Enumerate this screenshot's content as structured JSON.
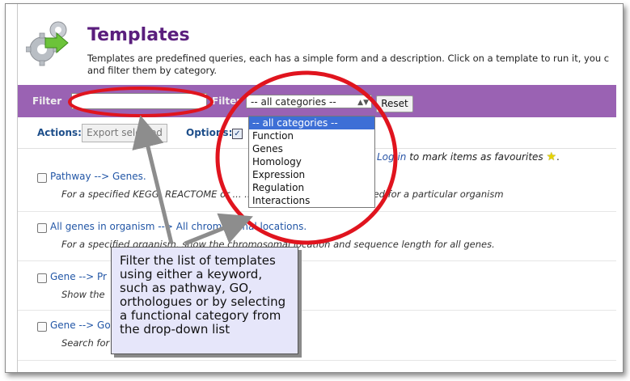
{
  "header": {
    "title": "Templates",
    "description_line1": "Templates are predefined queries, each has a simple form and a description. Click on a template to run it, you c",
    "description_line2": "and filter them by category."
  },
  "filterbar": {
    "filter_label1": "Filter",
    "filter_label2": "Filter",
    "text_value": "",
    "category_selected": "-- all categories --",
    "reset_label": "Reset"
  },
  "actions": {
    "label": "Actions:",
    "export_label": "Export selected",
    "options_label": "Options:"
  },
  "favourites": {
    "login_link": "Log in",
    "text": " to mark items as favourites",
    "period": "."
  },
  "templates": [
    {
      "name": "Pathway --> Genes.",
      "desc": "For a specified KEGG, REACTOME or ...     ... the genes that are involved for a particular organism"
    },
    {
      "name": "All genes in organism --> All chromosomal locations.",
      "desc": "For a specified organism, show the chromosomal location and sequence length for all genes."
    },
    {
      "name": "Gene --> Pr",
      "desc": "Show the"
    },
    {
      "name": "Gene --> Go",
      "desc": "Search for"
    }
  ],
  "dropdown": {
    "options": [
      "-- all categories --",
      "Function",
      "Genes",
      "Homology",
      "Expression",
      "Regulation",
      "Interactions"
    ]
  },
  "callout": {
    "text": "Filter the list of templates using either a keyword, such as pathway, GO, orthologues or by selecting a functional category from the drop-down list"
  },
  "colors": {
    "accent_purple": "#9a62b3",
    "title_purple": "#5a1e7d",
    "highlight_red": "#e0141e",
    "link_blue": "#2256a6"
  }
}
